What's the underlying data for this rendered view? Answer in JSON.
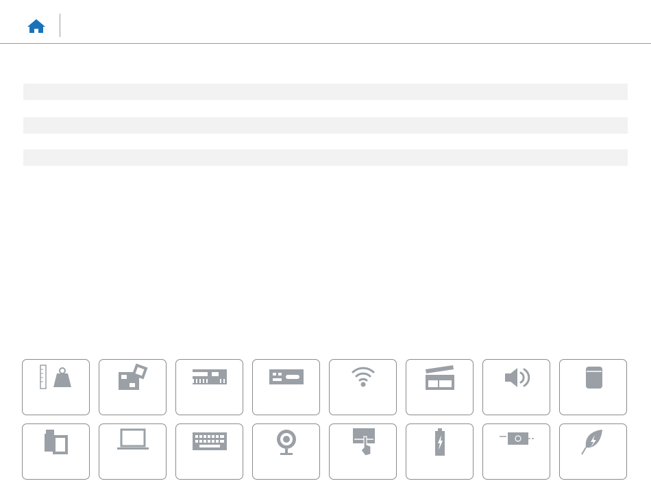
{
  "header": {
    "home_icon": "home-icon",
    "accent_color": "#1a73b8"
  },
  "info_rows": [
    {
      "label": ""
    },
    {
      "label": ""
    },
    {
      "label": ""
    }
  ],
  "tiles": [
    {
      "icon": "weight-dimensions-icon"
    },
    {
      "icon": "system-board-icon"
    },
    {
      "icon": "memory-icon"
    },
    {
      "icon": "ports-icon"
    },
    {
      "icon": "wifi-icon"
    },
    {
      "icon": "media-clapper-icon"
    },
    {
      "icon": "speaker-icon"
    },
    {
      "icon": "storage-drive-icon"
    },
    {
      "icon": "media-card-icon"
    },
    {
      "icon": "display-laptop-icon"
    },
    {
      "icon": "keyboard-icon"
    },
    {
      "icon": "camera-icon"
    },
    {
      "icon": "touchpad-icon"
    },
    {
      "icon": "battery-icon"
    },
    {
      "icon": "power-adapter-icon"
    },
    {
      "icon": "environmental-leaf-icon"
    }
  ],
  "colors": {
    "tile_border": "#8a8a8a",
    "icon_gray": "#9aa0a6",
    "row_fill": "#f2f2f2"
  }
}
